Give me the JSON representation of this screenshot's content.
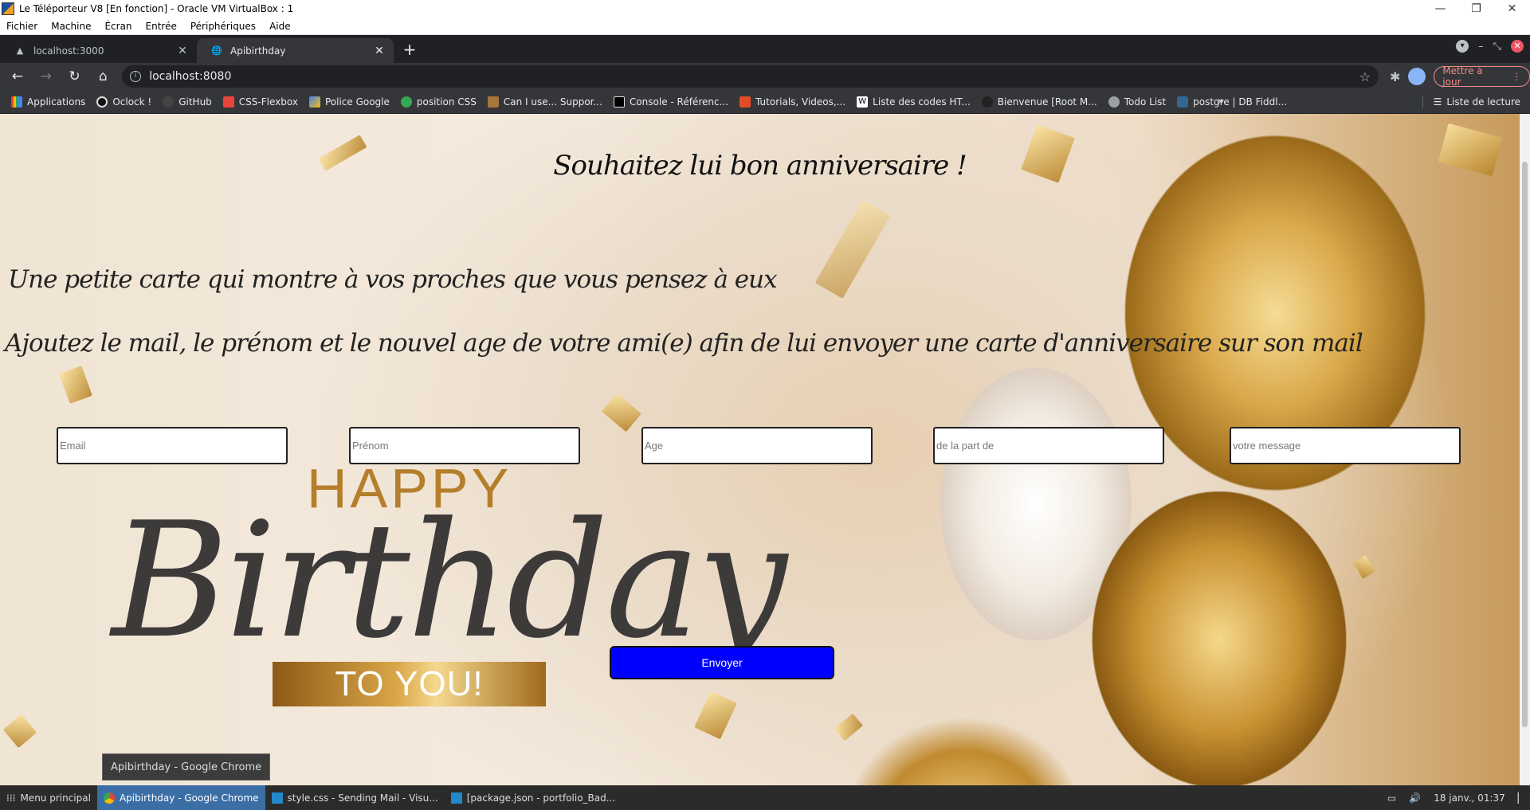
{
  "vbox": {
    "title": "Le Téléporteur V8 [En fonction] - Oracle VM VirtualBox : 1",
    "menu": [
      "Fichier",
      "Machine",
      "Écran",
      "Entrée",
      "Périphériques",
      "Aide"
    ]
  },
  "chrome": {
    "tabs": [
      {
        "label": "localhost:3000",
        "icon": "vercel-triangle-icon"
      },
      {
        "label": "Apibirthday",
        "icon": "globe-icon"
      }
    ],
    "url": "localhost:8080",
    "update_label": "Mettre à jour",
    "bookmarks": [
      {
        "label": "Applications",
        "color": "#ea4335"
      },
      {
        "label": "Oclock !",
        "color": "#111111"
      },
      {
        "label": "GitHub",
        "color": "#444444"
      },
      {
        "label": "CSS-Flexbox",
        "color": "#e8453c"
      },
      {
        "label": "Police Google",
        "color": "#4285f4"
      },
      {
        "label": "position CSS",
        "color": "#34a853"
      },
      {
        "label": "Can I use... Suppor...",
        "color": "#a5773a"
      },
      {
        "label": "Console - Référenc...",
        "color": "#000000"
      },
      {
        "label": "Tutorials, Videos,...",
        "color": "#e34c26"
      },
      {
        "label": "Liste des codes HT...",
        "color": "#ffffff"
      },
      {
        "label": "Bienvenue [Root M...",
        "color": "#222222"
      },
      {
        "label": "Todo List",
        "color": "#5f6368"
      },
      {
        "label": "postgre | DB Fiddl...",
        "color": "#336791"
      }
    ],
    "reading_list": "Liste de lecture"
  },
  "page": {
    "headline": "Souhaitez lui bon anniversaire !",
    "line1": "Une petite carte qui montre à vos proches que vous pensez à eux",
    "line2": "Ajoutez le mail, le prénom et le nouvel age de votre ami(e) afin de lui envoyer une carte d'anniversaire sur son mail",
    "fields": {
      "email": "Email",
      "prenom": "Prénom",
      "age": "Age",
      "from": "de la part de",
      "message": "votre message"
    },
    "happy": "HAPPY",
    "birthday": "Birthday",
    "to_you": "TO YOU!",
    "send": "Envoyer",
    "send_color": "#0000ff"
  },
  "tooltip": "Apibirthday - Google Chrome",
  "taskbar": {
    "menu": "Menu principal",
    "tasks": [
      {
        "label": "Apibirthday - Google Chrome",
        "active": true
      },
      {
        "label": "style.css - Sending Mail - Visu...",
        "active": false
      },
      {
        "label": "[package.json - portfolio_Bad...",
        "active": false
      }
    ],
    "clock": "18 janv., 01:37"
  }
}
